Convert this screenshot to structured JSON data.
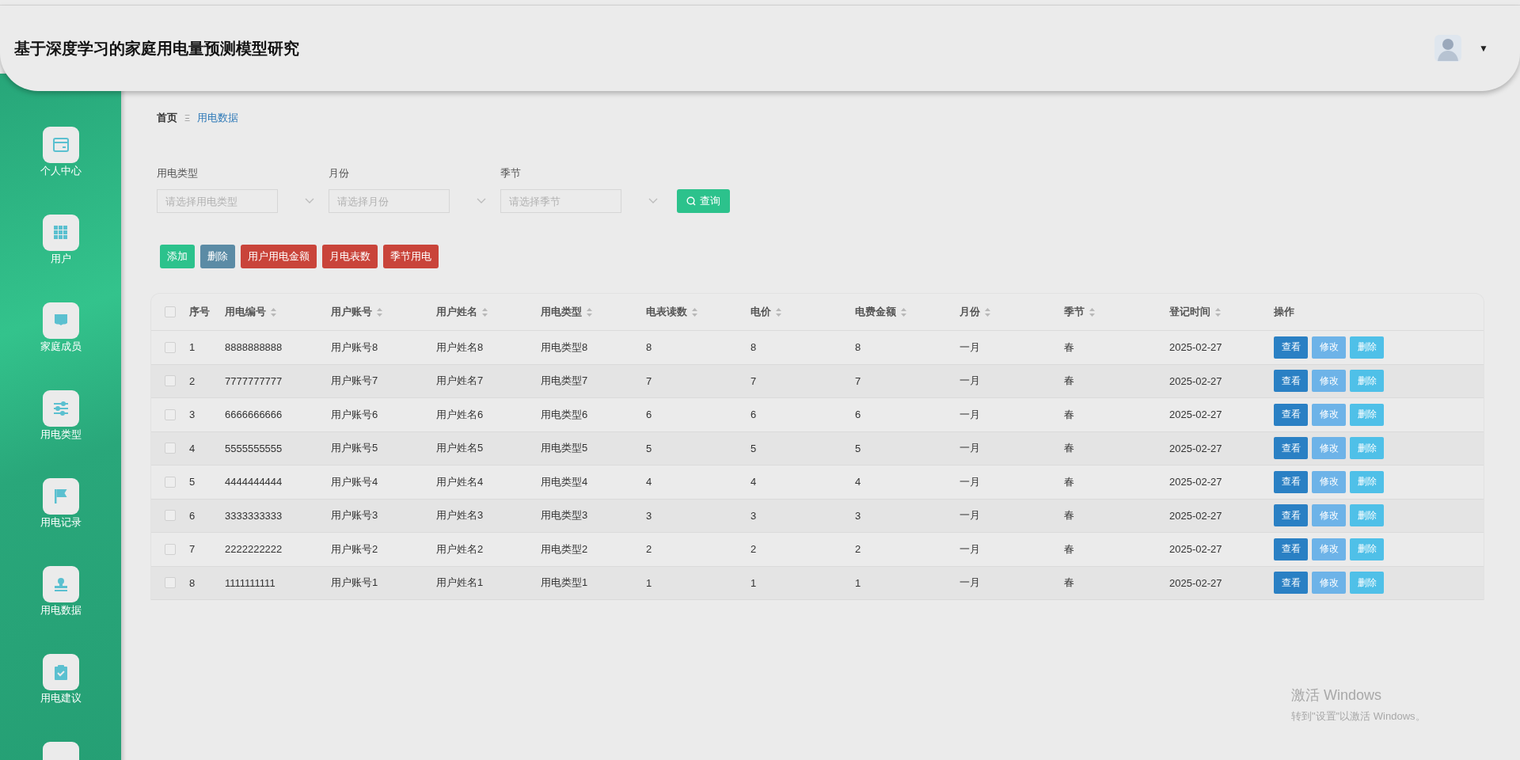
{
  "header": {
    "title": "基于深度学习的家庭用电量预测模型研究",
    "user_menu_caret": "▼"
  },
  "sidebar": {
    "items": [
      {
        "label": "个人中心"
      },
      {
        "label": "用户"
      },
      {
        "label": "家庭成员"
      },
      {
        "label": "用电类型"
      },
      {
        "label": "用电记录"
      },
      {
        "label": "用电数据"
      },
      {
        "label": "用电建议"
      }
    ]
  },
  "breadcrumb": {
    "items": [
      "首页",
      "用电数据"
    ],
    "separator": "Ξ"
  },
  "filters": [
    {
      "label": "用电类型",
      "placeholder": "请选择用电类型"
    },
    {
      "label": "月份",
      "placeholder": "请选择月份"
    },
    {
      "label": "季节",
      "placeholder": "请选择季节"
    }
  ],
  "search_button": "查询",
  "actions": [
    {
      "label": "添加",
      "kind": "add"
    },
    {
      "label": "删除",
      "kind": "delete"
    },
    {
      "label": "用户用电金额",
      "kind": "report"
    },
    {
      "label": "月电表数",
      "kind": "report"
    },
    {
      "label": "季节用电",
      "kind": "report"
    }
  ],
  "table": {
    "select_all_checked": false,
    "columns": [
      {
        "label": "序号",
        "sortable": false
      },
      {
        "label": "用电编号",
        "sortable": true
      },
      {
        "label": "用户账号",
        "sortable": true
      },
      {
        "label": "用户姓名",
        "sortable": true
      },
      {
        "label": "用电类型",
        "sortable": true
      },
      {
        "label": "电表读数",
        "sortable": true
      },
      {
        "label": "电价",
        "sortable": true
      },
      {
        "label": "电费金额",
        "sortable": true
      },
      {
        "label": "月份",
        "sortable": true
      },
      {
        "label": "季节",
        "sortable": true
      },
      {
        "label": "登记时间",
        "sortable": true
      },
      {
        "label": "操作",
        "sortable": false
      }
    ],
    "rows": [
      {
        "checked": false,
        "cells": [
          "1",
          "8888888888",
          "用户账号8",
          "用户姓名8",
          "用电类型8",
          "8",
          "8",
          "8",
          "一月",
          "春",
          "2025-02-27"
        ],
        "actions": [
          {
            "label": "查看",
            "kind": "view"
          },
          {
            "label": "修改",
            "kind": "edit"
          },
          {
            "label": "删除",
            "kind": "delete"
          }
        ]
      },
      {
        "checked": false,
        "cells": [
          "2",
          "7777777777",
          "用户账号7",
          "用户姓名7",
          "用电类型7",
          "7",
          "7",
          "7",
          "一月",
          "春",
          "2025-02-27"
        ],
        "actions": [
          {
            "label": "查看",
            "kind": "view"
          },
          {
            "label": "修改",
            "kind": "edit"
          },
          {
            "label": "删除",
            "kind": "delete"
          }
        ]
      },
      {
        "checked": false,
        "cells": [
          "3",
          "6666666666",
          "用户账号6",
          "用户姓名6",
          "用电类型6",
          "6",
          "6",
          "6",
          "一月",
          "春",
          "2025-02-27"
        ],
        "actions": [
          {
            "label": "查看",
            "kind": "view"
          },
          {
            "label": "修改",
            "kind": "edit"
          },
          {
            "label": "删除",
            "kind": "delete"
          }
        ]
      },
      {
        "checked": false,
        "cells": [
          "4",
          "5555555555",
          "用户账号5",
          "用户姓名5",
          "用电类型5",
          "5",
          "5",
          "5",
          "一月",
          "春",
          "2025-02-27"
        ],
        "actions": [
          {
            "label": "查看",
            "kind": "view"
          },
          {
            "label": "修改",
            "kind": "edit"
          },
          {
            "label": "删除",
            "kind": "delete"
          }
        ]
      },
      {
        "checked": false,
        "cells": [
          "5",
          "4444444444",
          "用户账号4",
          "用户姓名4",
          "用电类型4",
          "4",
          "4",
          "4",
          "一月",
          "春",
          "2025-02-27"
        ],
        "actions": [
          {
            "label": "查看",
            "kind": "view"
          },
          {
            "label": "修改",
            "kind": "edit"
          },
          {
            "label": "删除",
            "kind": "delete"
          }
        ]
      },
      {
        "checked": false,
        "cells": [
          "6",
          "3333333333",
          "用户账号3",
          "用户姓名3",
          "用电类型3",
          "3",
          "3",
          "3",
          "一月",
          "春",
          "2025-02-27"
        ],
        "actions": [
          {
            "label": "查看",
            "kind": "view"
          },
          {
            "label": "修改",
            "kind": "edit"
          },
          {
            "label": "删除",
            "kind": "delete"
          }
        ]
      },
      {
        "checked": false,
        "cells": [
          "7",
          "2222222222",
          "用户账号2",
          "用户姓名2",
          "用电类型2",
          "2",
          "2",
          "2",
          "一月",
          "春",
          "2025-02-27"
        ],
        "actions": [
          {
            "label": "查看",
            "kind": "view"
          },
          {
            "label": "修改",
            "kind": "edit"
          },
          {
            "label": "删除",
            "kind": "delete"
          }
        ]
      },
      {
        "checked": false,
        "cells": [
          "8",
          "1111111111",
          "用户账号1",
          "用户姓名1",
          "用电类型1",
          "1",
          "1",
          "1",
          "一月",
          "春",
          "2025-02-27"
        ],
        "actions": [
          {
            "label": "查看",
            "kind": "view"
          },
          {
            "label": "修改",
            "kind": "edit"
          },
          {
            "label": "删除",
            "kind": "delete"
          }
        ]
      }
    ]
  },
  "windows_activation": {
    "title": "激活 Windows",
    "subtitle": "转到\"设置\"以激活 Windows。"
  }
}
